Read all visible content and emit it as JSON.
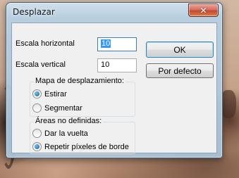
{
  "dialog": {
    "title": "Desplazar",
    "close_symbol": "✕"
  },
  "fields": {
    "horizontal_label": "Escala horizontal",
    "horizontal_value": "10",
    "vertical_label": "Escala vertical",
    "vertical_value": "10"
  },
  "buttons": {
    "ok_label": "OK",
    "default_label": "Por defecto"
  },
  "map_group": {
    "legend": "Mapa de desplazamiento:",
    "options": [
      "Estirar",
      "Segmentar"
    ],
    "selected": "Estirar"
  },
  "areas_group": {
    "legend": "Áreas no definidas:",
    "options": [
      "Dar la vuelta",
      "Repetir píxeles de borde"
    ],
    "selected": "Repetir píxeles de borde"
  },
  "colors": {
    "close_button": "#c94a36",
    "selection": "#3399ff",
    "focus_border": "#3c7fb1"
  },
  "icons": {
    "close": "close-icon",
    "radio": "radio-button"
  }
}
